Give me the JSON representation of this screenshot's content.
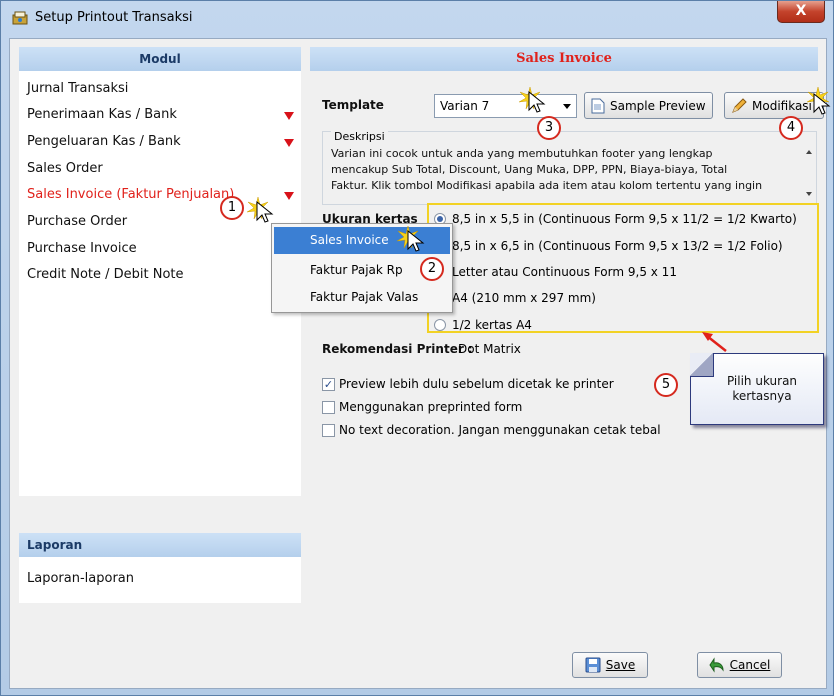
{
  "window": {
    "title": "Setup Printout Transaksi",
    "close_glyph": "X"
  },
  "left": {
    "modul_header": "Modul",
    "items": [
      {
        "label": "Jurnal Transaksi"
      },
      {
        "label": "Penerimaan Kas / Bank"
      },
      {
        "label": "Pengeluaran Kas / Bank"
      },
      {
        "label": "Sales Order"
      },
      {
        "label": "Sales Invoice (Faktur Penjualan)"
      },
      {
        "label": "Purchase Order"
      },
      {
        "label": "Purchase Invoice"
      },
      {
        "label": "Credit Note / Debit Note"
      }
    ],
    "laporan_header": "Laporan",
    "laporan_items": [
      {
        "label": "Laporan-laporan"
      }
    ]
  },
  "context_menu": {
    "items": [
      {
        "label": "Sales Invoice"
      },
      {
        "label": "Faktur Pajak Rp"
      },
      {
        "label": "Faktur Pajak Valas"
      }
    ]
  },
  "right": {
    "header": "Sales Invoice",
    "template_label": "Template",
    "template_value": "Varian 7",
    "sample_preview_label": "Sample Preview",
    "modifikasi_label": "Modifikasi",
    "deskripsi_label": "Deskripsi",
    "deskripsi_lines": [
      "Varian ini cocok untuk anda yang membutuhkan footer yang lengkap",
      "mencakup Sub Total, Discount, Uang Muka, DPP, PPN, Biaya-biaya, Total",
      "Faktur. Klik tombol Modifikasi apabila ada item atau kolom tertentu yang ingin"
    ],
    "ukuran_label": "Ukuran kertas",
    "paper_options": [
      {
        "label": "8,5 in x 5,5 in (Continuous Form 9,5 x 11/2 = 1/2 Kwarto)",
        "selected": true
      },
      {
        "label": "8,5 in x 6,5 in (Continuous Form 9,5 x 13/2 = 1/2 Folio)",
        "selected": false
      },
      {
        "label": "Letter atau Continuous Form 9,5 x 11",
        "selected": false
      },
      {
        "label": "A4 (210 mm x 297 mm)",
        "selected": false
      },
      {
        "label": "1/2 kertas A4",
        "selected": false
      }
    ],
    "rekomendasi_label": "Rekomendasi Printer :",
    "rekomendasi_value": "Dot Matrix",
    "checkboxes": [
      {
        "label": "Preview lebih dulu sebelum dicetak ke printer",
        "checked": true
      },
      {
        "label": "Menggunakan preprinted form",
        "checked": false
      },
      {
        "label": "No text decoration. Jangan menggunakan cetak tebal",
        "checked": false
      }
    ],
    "save_label": "Save",
    "cancel_label": "Cancel"
  },
  "annotations": {
    "badges": [
      "1",
      "2",
      "3",
      "4",
      "5"
    ],
    "callout_lines": [
      "Pilih ukuran",
      "kertasnya"
    ]
  },
  "colors": {
    "accent_red": "#e0211b",
    "highlight_blue": "#3b7fd3",
    "annotation_yellow": "#f2d224",
    "badge_red": "#d5291e"
  }
}
